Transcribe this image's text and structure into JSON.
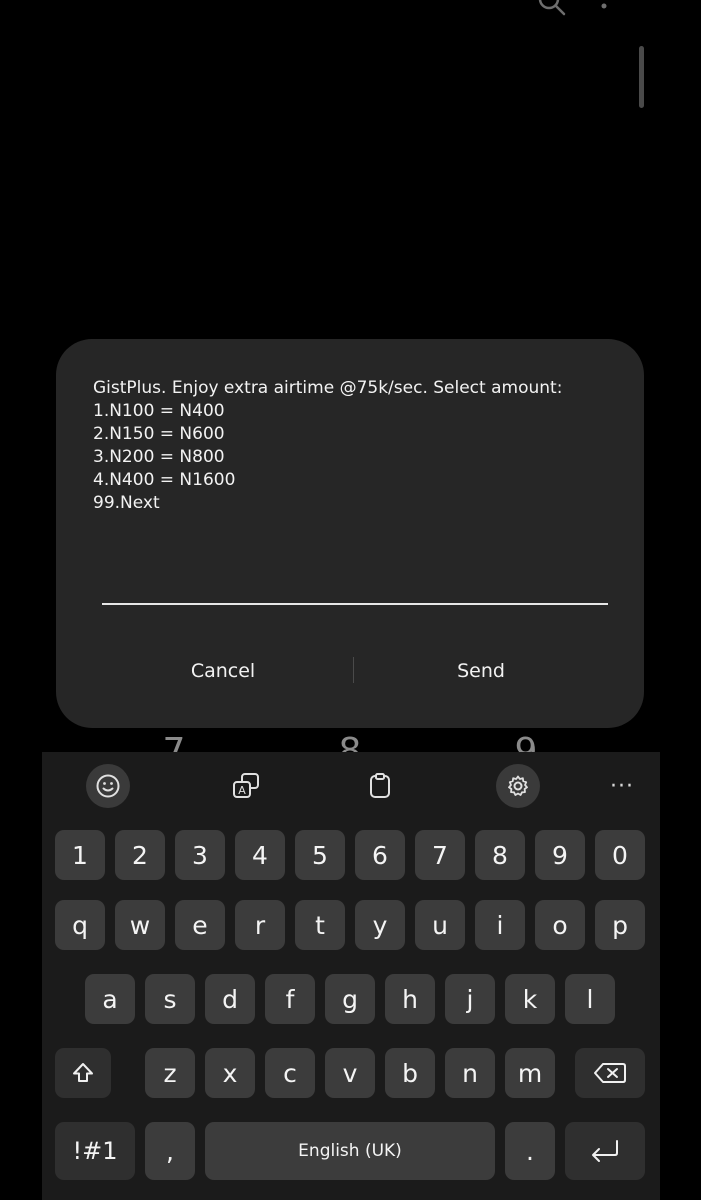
{
  "background_digits": [
    "7",
    "8",
    "9"
  ],
  "dialog": {
    "message": "GistPlus. Enjoy extra airtime @75k/sec. Select amount:\n1.N100 = N400\n2.N150 = N600\n3.N200 = N800\n4.N400 = N1600\n99.Next",
    "input_value": "",
    "cancel_label": "Cancel",
    "send_label": "Send"
  },
  "keyboard": {
    "toolbar": [
      "emoji-icon",
      "translate-icon",
      "clipboard-icon",
      "settings-icon",
      "more-icon"
    ],
    "more_label": "···",
    "row_numbers": [
      "1",
      "2",
      "3",
      "4",
      "5",
      "6",
      "7",
      "8",
      "9",
      "0"
    ],
    "row1": [
      "q",
      "w",
      "e",
      "r",
      "t",
      "y",
      "u",
      "i",
      "o",
      "p"
    ],
    "row2": [
      "a",
      "s",
      "d",
      "f",
      "g",
      "h",
      "j",
      "k",
      "l"
    ],
    "row3": [
      "z",
      "x",
      "c",
      "v",
      "b",
      "n",
      "m"
    ],
    "symbols_label": "!#1",
    "comma_label": ",",
    "space_label": "English (UK)",
    "period_label": "."
  }
}
